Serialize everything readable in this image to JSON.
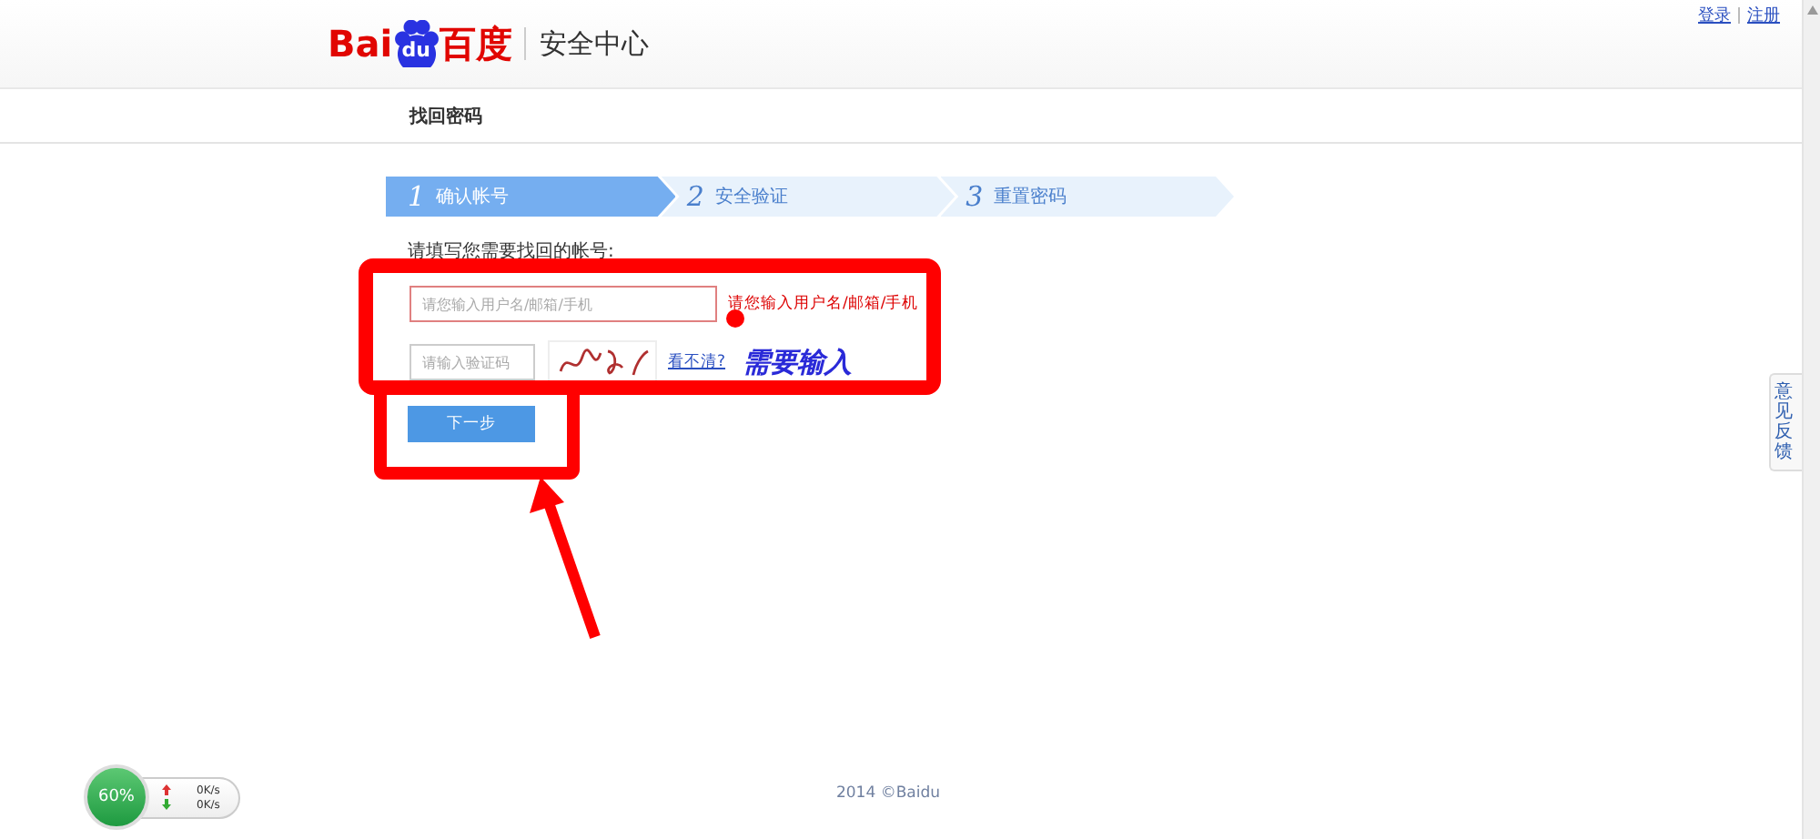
{
  "top_links": [
    {
      "label": "登录"
    },
    {
      "label": "注册"
    }
  ],
  "logo": {
    "latin": "Bai",
    "paw": "du",
    "chinese": "百度"
  },
  "site_title": "安全中心",
  "page_title": "找回密码",
  "steps": [
    {
      "number": "1",
      "label": "确认帐号",
      "selected": true
    },
    {
      "number": "2",
      "label": "安全验证",
      "selected": false
    },
    {
      "number": "3",
      "label": "重置密码",
      "selected": false
    }
  ],
  "form": {
    "prompt": "请填写您需要找回的帐号:",
    "account_placeholder": "请您输入用户名/邮箱/手机",
    "account_invalid": true,
    "account_error": "请您输入用户名/邮箱/手机",
    "captcha_placeholder": "请输入验证码",
    "refresh_link": "看不清?",
    "next_button": "下一步"
  },
  "annotation": {
    "note": "需要输入"
  },
  "feedback_tab": "意见反馈",
  "speed_widget": {
    "percent": "60%",
    "upload": "0K/s",
    "download": "0K/s"
  },
  "footer": "2014 ©Baidu"
}
